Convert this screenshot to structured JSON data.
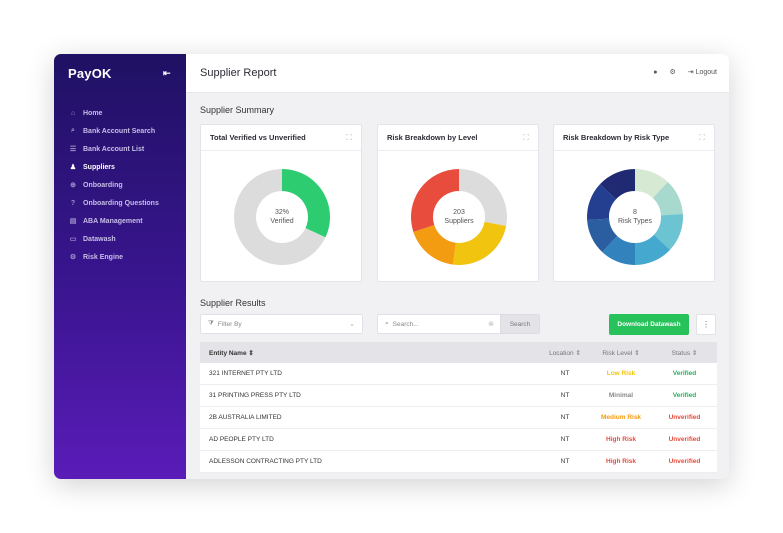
{
  "sidebar": {
    "logo": "PayOK",
    "collapse_icon": "collapse-left-icon",
    "items": [
      {
        "label": "Home",
        "icon": "⌂"
      },
      {
        "label": "Bank Account Search",
        "icon": "⌕"
      },
      {
        "label": "Bank Account List",
        "icon": "☰"
      },
      {
        "label": "Suppliers",
        "icon": "♟"
      },
      {
        "label": "Onboarding",
        "icon": "⊕"
      },
      {
        "label": "Onboarding Questions",
        "icon": "?"
      },
      {
        "label": "ABA Management",
        "icon": "▤"
      },
      {
        "label": "Datawash",
        "icon": "▭"
      },
      {
        "label": "Risk Engine",
        "icon": "⚙"
      }
    ],
    "active_index": 3
  },
  "header": {
    "title": "Supplier Report",
    "logout_label": "Logout"
  },
  "summary": {
    "title": "Supplier Summary",
    "cards": [
      {
        "title": "Total Verified vs Unverified",
        "center_value": "32%",
        "center_label": "Verified",
        "segments": [
          {
            "value": 32,
            "color": "#2ecc71"
          },
          {
            "value": 68,
            "color": "#dcdcdc"
          }
        ]
      },
      {
        "title": "Risk Breakdown by Level",
        "center_value": "203",
        "center_label": "Suppliers",
        "segments": [
          {
            "value": 28,
            "color": "#dcdcdc"
          },
          {
            "value": 24,
            "color": "#f1c40f"
          },
          {
            "value": 18,
            "color": "#f39c12"
          },
          {
            "value": 30,
            "color": "#e74c3c"
          }
        ]
      },
      {
        "title": "Risk Breakdown by Risk Type",
        "center_value": "8",
        "center_label": "Risk Types",
        "segments": [
          {
            "value": 12,
            "color": "#d6e9d3"
          },
          {
            "value": 12,
            "color": "#a8d9cf"
          },
          {
            "value": 13,
            "color": "#6cc3d1"
          },
          {
            "value": 13,
            "color": "#45a9cf"
          },
          {
            "value": 12,
            "color": "#3182bd"
          },
          {
            "value": 12,
            "color": "#2b5da1"
          },
          {
            "value": 13,
            "color": "#253f90"
          },
          {
            "value": 13,
            "color": "#1f2a73"
          }
        ]
      }
    ]
  },
  "results": {
    "title": "Supplier Results",
    "filter_placeholder": "Filter By",
    "search_placeholder": "Search...",
    "search_button": "Search",
    "download_button": "Download Datawash",
    "more_icon": "⋮",
    "columns": {
      "name": "Entity Name ⇕",
      "location": "Location ⇕",
      "risk": "Risk Level ⇕",
      "status": "Status ⇕"
    },
    "rows": [
      {
        "name": "321 INTERNET PTY LTD",
        "location": "NT",
        "risk": "Low Risk",
        "risk_color": "#f1c40f",
        "status": "Verified",
        "status_color": "#27ae60"
      },
      {
        "name": "31 PRINTING PRESS PTY LTD",
        "location": "NT",
        "risk": "Minimal",
        "risk_color": "#888888",
        "status": "Verified",
        "status_color": "#27ae60"
      },
      {
        "name": "2B AUSTRALIA LIMITED",
        "location": "NT",
        "risk": "Medium Risk",
        "risk_color": "#f39c12",
        "status": "Unverified",
        "status_color": "#e74c3c"
      },
      {
        "name": "AD PEOPLE PTY LTD",
        "location": "NT",
        "risk": "High Risk",
        "risk_color": "#e74c3c",
        "status": "Unverified",
        "status_color": "#e74c3c"
      },
      {
        "name": "ADLESSON CONTRACTING PTY LTD",
        "location": "NT",
        "risk": "High Risk",
        "risk_color": "#e74c3c",
        "status": "Unverified",
        "status_color": "#e74c3c"
      }
    ]
  }
}
